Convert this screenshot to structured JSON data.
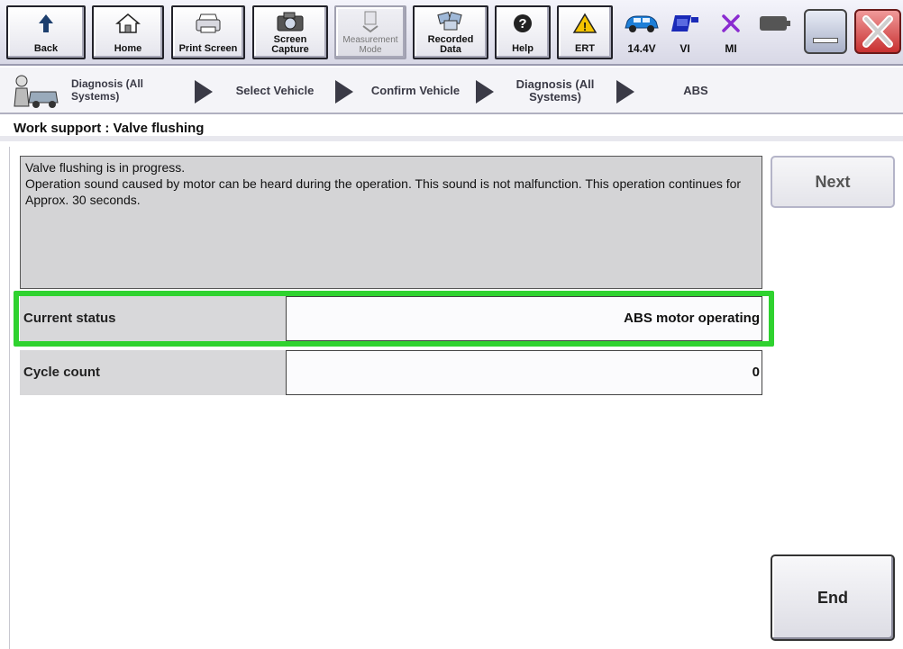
{
  "toolbar": {
    "back": "Back",
    "home": "Home",
    "print_screen": "Print Screen",
    "screen_capture_1": "Screen",
    "screen_capture_2": "Capture",
    "measurement_1": "Measurement",
    "measurement_2": "Mode",
    "recorded_1": "Recorded",
    "recorded_2": "Data",
    "help": "Help",
    "ert": "ERT",
    "voltage": "14.4V",
    "vi": "VI",
    "mi": "MI"
  },
  "breadcrumb": {
    "root_1": "Diagnosis (All",
    "root_2": "Systems)",
    "select_vehicle": "Select Vehicle",
    "confirm_vehicle": "Confirm Vehicle",
    "diag_1": "Diagnosis (All",
    "diag_2": "Systems)",
    "abs": "ABS"
  },
  "page": {
    "title": "Work support : Valve flushing"
  },
  "message": {
    "line1": "Valve flushing is in progress.",
    "line2": "Operation sound caused by motor can be heard during the operation. This sound is not malfunction. This operation continues for Approx. 30 seconds."
  },
  "rows": [
    {
      "label": "Current status",
      "value": "ABS motor operating"
    },
    {
      "label": "Cycle count",
      "value": "0"
    }
  ],
  "buttons": {
    "next": "Next",
    "end": "End"
  },
  "colors": {
    "highlight": "#2fd22f",
    "warning": "#f5c400",
    "vehicle": "#1e7fd8",
    "vi": "#1a2ab8",
    "mi": "#8a2bd0",
    "close": "#e05050"
  }
}
